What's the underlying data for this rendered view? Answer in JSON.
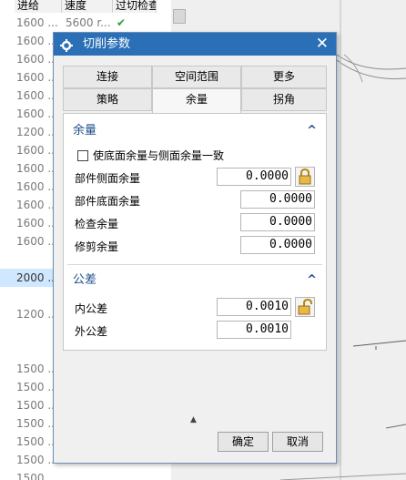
{
  "background_table": {
    "headers": [
      "进给",
      "速度",
      "过切检查"
    ],
    "rows": [
      {
        "feed": "1600 ...",
        "speed": "5600 r...",
        "check": "✔"
      },
      {
        "feed": "1600 ...",
        "speed": "",
        "check": ""
      },
      {
        "feed": "1600 ...",
        "speed": "",
        "check": ""
      },
      {
        "feed": "1600 ...",
        "speed": "",
        "check": ""
      },
      {
        "feed": "1600 ...",
        "speed": "",
        "check": ""
      },
      {
        "feed": "1600 ...",
        "speed": "",
        "check": ""
      },
      {
        "feed": "1200 ...",
        "speed": "",
        "check": ""
      },
      {
        "feed": "1600 ...",
        "speed": "",
        "check": ""
      },
      {
        "feed": "1600 ...",
        "speed": "",
        "check": ""
      },
      {
        "feed": "1600 ...",
        "speed": "",
        "check": ""
      },
      {
        "feed": "1600 ...",
        "speed": "",
        "check": ""
      },
      {
        "feed": "1600 ...",
        "speed": "",
        "check": ""
      },
      {
        "feed": "1600 ...",
        "speed": "",
        "check": ""
      },
      {
        "feed": "",
        "speed": "",
        "check": ""
      },
      {
        "feed": "2000 ...",
        "speed": "",
        "check": ""
      },
      {
        "feed": "",
        "speed": "",
        "check": ""
      },
      {
        "feed": "1200 ...",
        "speed": "",
        "check": ""
      },
      {
        "feed": "",
        "speed": "",
        "check": ""
      },
      {
        "feed": "",
        "speed": "",
        "check": ""
      },
      {
        "feed": "1500 ...",
        "speed": "",
        "check": ""
      },
      {
        "feed": "1500 ...",
        "speed": "",
        "check": ""
      },
      {
        "feed": "1500 ...",
        "speed": "",
        "check": ""
      },
      {
        "feed": "1500 ...",
        "speed": "",
        "check": ""
      },
      {
        "feed": "1500 ...",
        "speed": "",
        "check": ""
      },
      {
        "feed": "1500 ...",
        "speed": "",
        "check": ""
      },
      {
        "feed": "1500 ...",
        "speed": "",
        "check": ""
      }
    ]
  },
  "dialog": {
    "title": "切削参数",
    "tabs_row1": [
      "连接",
      "空间范围",
      "更多"
    ],
    "tabs_row2": [
      "策略",
      "余量",
      "拐角"
    ],
    "active_tab": "余量",
    "stock_section": {
      "title": "余量",
      "checkbox_label": "使底面余量与侧面余量一致",
      "checkbox_checked": false,
      "fields": [
        {
          "label": "部件侧面余量",
          "value": "0.0000"
        },
        {
          "label": "部件底面余量",
          "value": "0.0000"
        },
        {
          "label": "检查余量",
          "value": "0.0000"
        },
        {
          "label": "修剪余量",
          "value": "0.0000"
        }
      ]
    },
    "tolerance_section": {
      "title": "公差",
      "fields": [
        {
          "label": "内公差",
          "value": "0.0010"
        },
        {
          "label": "外公差",
          "value": "0.0010"
        }
      ]
    },
    "buttons": {
      "ok": "确定",
      "cancel": "取消"
    }
  },
  "colors": {
    "title_bar": "#2b6fb6",
    "section_text": "#1f4f8a",
    "selected_row": "#cfe8ff",
    "check": "#2aa035"
  }
}
